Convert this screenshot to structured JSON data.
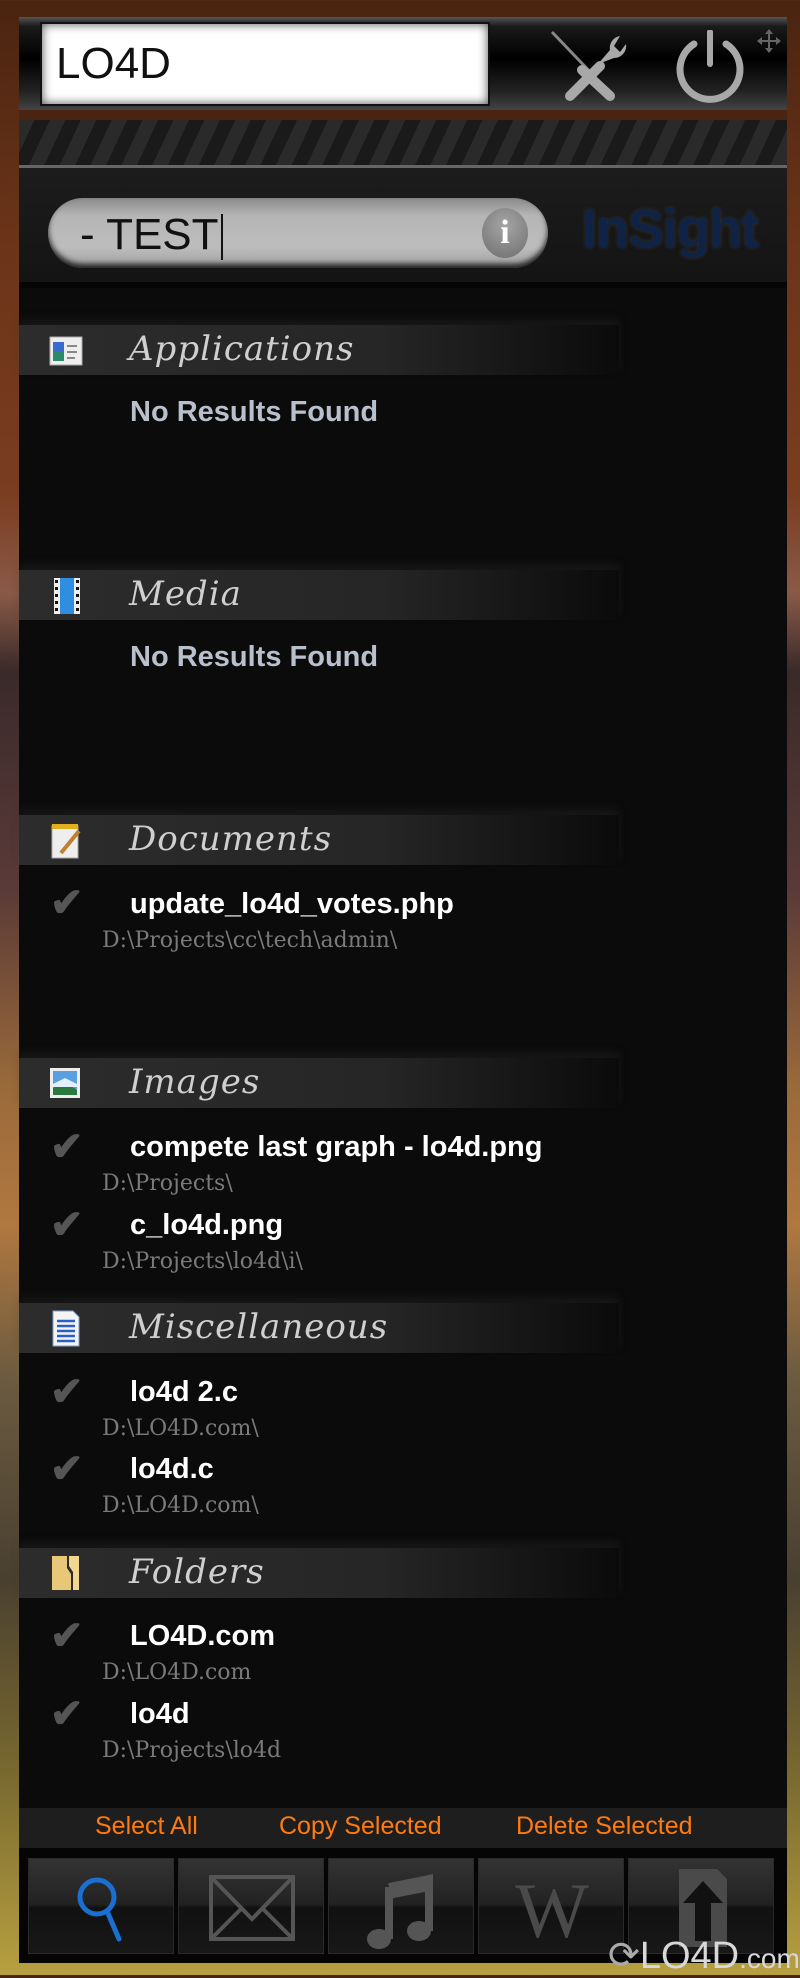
{
  "app": {
    "name": "InSight"
  },
  "topbar": {
    "input_value": "LO4D",
    "settings_icon": "tools-icon",
    "power_icon": "power-icon",
    "move_icon": "move-icon"
  },
  "search": {
    "query": "- TEST",
    "info_label": "i"
  },
  "sections": [
    {
      "title": "Applications",
      "icon": "application-window-icon",
      "empty_text": "No Results Found",
      "items": []
    },
    {
      "title": "Media",
      "icon": "film-strip-icon",
      "empty_text": "No Results Found",
      "items": []
    },
    {
      "title": "Documents",
      "icon": "notepad-icon",
      "items": [
        {
          "name": "update_lo4d_votes.php",
          "path": "D:\\Projects\\cc\\tech\\admin\\"
        }
      ]
    },
    {
      "title": "Images",
      "icon": "picture-icon",
      "items": [
        {
          "name": "compete last graph - lo4d.png",
          "path": "D:\\Projects\\"
        },
        {
          "name": "c_lo4d.png",
          "path": "D:\\Projects\\lo4d\\i\\"
        }
      ]
    },
    {
      "title": "Miscellaneous",
      "icon": "text-file-icon",
      "items": [
        {
          "name": "lo4d 2.c",
          "path": "D:\\LO4D.com\\"
        },
        {
          "name": "lo4d.c",
          "path": "D:\\LO4D.com\\"
        }
      ]
    },
    {
      "title": "Folders",
      "icon": "folder-icon",
      "items": [
        {
          "name": "LO4D.com",
          "path": "D:\\LO4D.com"
        },
        {
          "name": "lo4d",
          "path": "D:\\Projects\\lo4d"
        }
      ]
    }
  ],
  "actions": {
    "select_all": "Select All",
    "copy_selected": "Copy Selected",
    "delete_selected": "Delete Selected"
  },
  "dock": [
    {
      "name": "search",
      "icon": "magnifier-icon",
      "active": true
    },
    {
      "name": "email",
      "icon": "envelope-icon",
      "active": false
    },
    {
      "name": "music",
      "icon": "music-note-icon",
      "active": false
    },
    {
      "name": "wikipedia",
      "icon": "wikipedia-w-icon",
      "active": false,
      "glyph": "W"
    },
    {
      "name": "upload",
      "icon": "upload-arrow-icon",
      "active": false
    }
  ],
  "watermark": {
    "text": "LO4D",
    "suffix": ".com"
  },
  "colors": {
    "accent_action": "#ff7a10",
    "active_dock": "#1a6fd0",
    "brand": "#0f2347"
  }
}
